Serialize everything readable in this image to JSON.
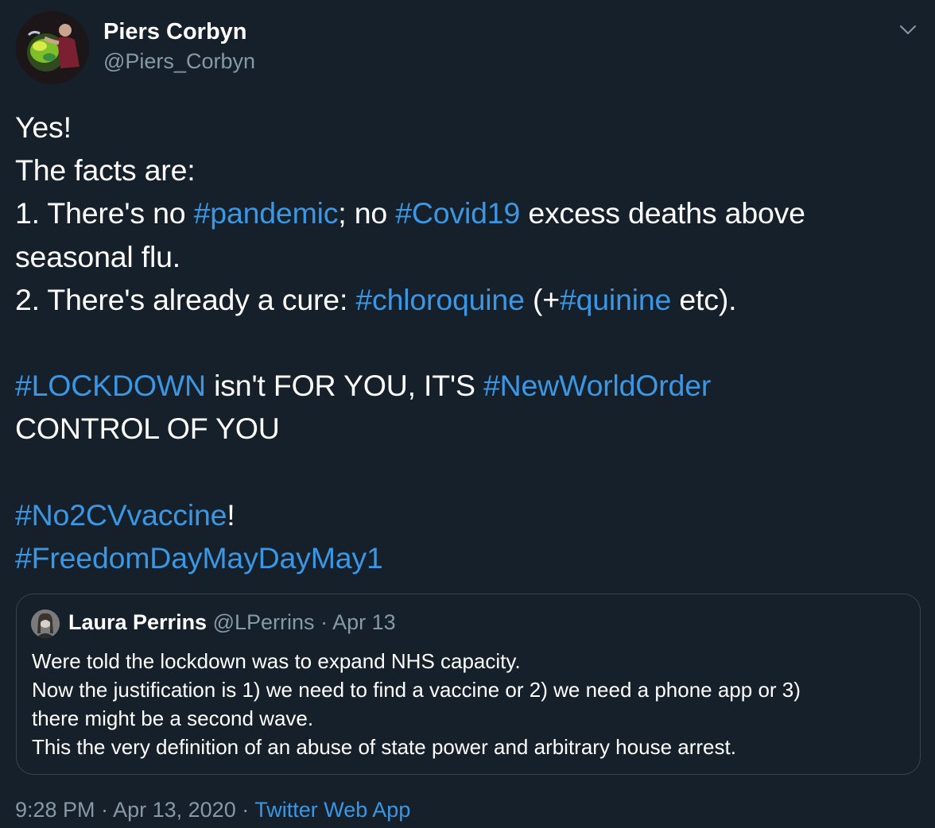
{
  "author": {
    "display_name": "Piers Corbyn",
    "handle": "@Piers_Corbyn"
  },
  "tweet": {
    "lines": [
      [
        {
          "t": "Yes!"
        }
      ],
      [
        {
          "t": "The facts are:"
        }
      ],
      [
        {
          "t": "1. There's no "
        },
        {
          "t": "#pandemic",
          "h": true
        },
        {
          "t": "; no "
        },
        {
          "t": "#Covid19",
          "h": true
        },
        {
          "t": " excess deaths above"
        }
      ],
      [
        {
          "t": "seasonal flu."
        }
      ],
      [
        {
          "t": "2. There's already a cure: "
        },
        {
          "t": "#chloroquine",
          "h": true
        },
        {
          "t": " (+"
        },
        {
          "t": "#quinine",
          "h": true
        },
        {
          "t": " etc)."
        }
      ],
      [],
      [
        {
          "t": "#LOCKDOWN",
          "h": true
        },
        {
          "t": " isn't FOR YOU, IT'S "
        },
        {
          "t": "#NewWorldOrder",
          "h": true
        }
      ],
      [
        {
          "t": "CONTROL OF YOU"
        }
      ],
      [],
      [
        {
          "t": "#No2CVvaccine",
          "h": true
        },
        {
          "t": "!"
        }
      ],
      [
        {
          "t": "#FreedomDayMayDayMay1",
          "h": true
        }
      ]
    ]
  },
  "quoted_tweet": {
    "display_name": "Laura Perrins",
    "handle": "@LPerrins",
    "separator": "·",
    "date": "Apr 13",
    "lines": [
      "Were told the lockdown was to expand NHS capacity.",
      "Now the justification is 1) we need to find a vaccine or 2) we need a phone app or 3)",
      "there might be a second wave.",
      "This the very definition of an abuse of state power and arbitrary house arrest."
    ]
  },
  "footer": {
    "time": "9:28 PM",
    "separator": "·",
    "date": "Apr 13, 2020",
    "source": "Twitter Web App"
  },
  "colors": {
    "background": "#15202b",
    "link": "#3b97e3",
    "secondary_text": "#8899a6",
    "border": "#38444d"
  },
  "icons": {
    "menu": "chevron-down-icon"
  }
}
